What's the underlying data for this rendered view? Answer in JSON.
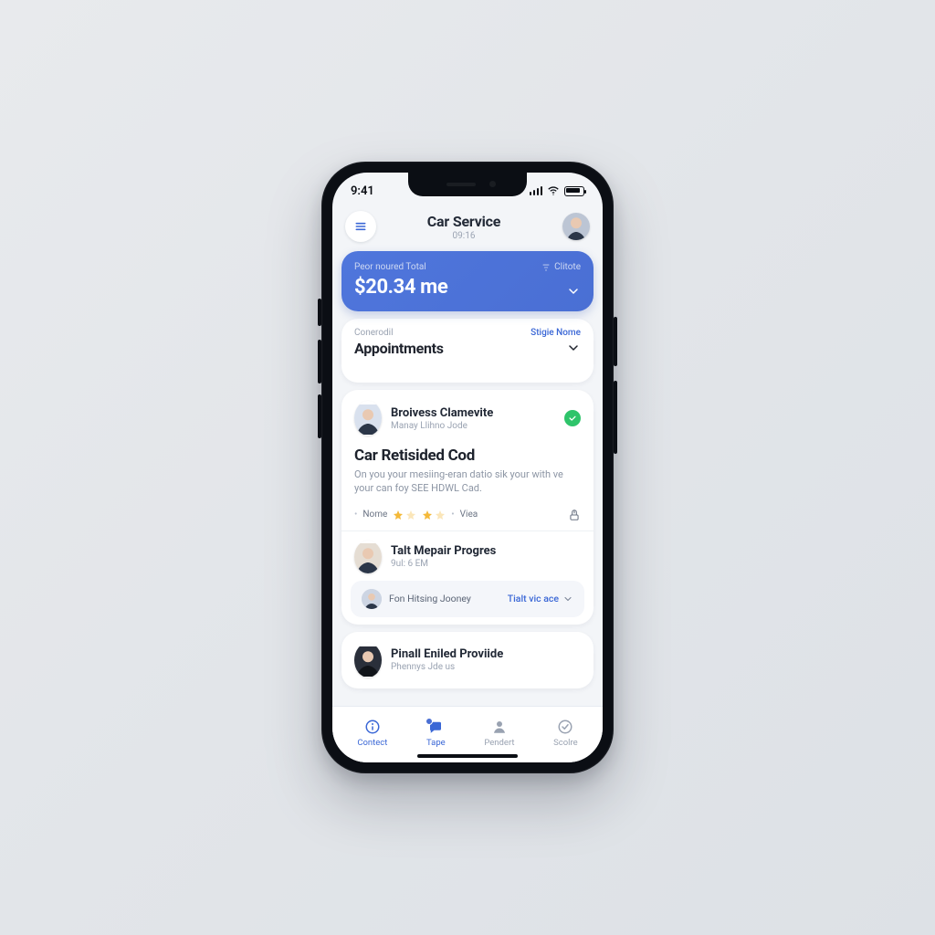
{
  "colors": {
    "accent": "#4a6fd4",
    "success": "#2ec46a",
    "star": "#f4b93a"
  },
  "status": {
    "time": "9:41"
  },
  "header": {
    "title": "Car Service",
    "subtitle": "09:16"
  },
  "total": {
    "label": "Peor noured Total",
    "right_label": "Clitote",
    "amount": "$20.34 me"
  },
  "appointments_section": {
    "overline": "Conerodil",
    "right_link": "Stigie Nome",
    "title": "Appointments"
  },
  "appointment1": {
    "name": "Broivess Clamevite",
    "meta": "Manay Llihno Jode",
    "job_title": "Car Retisided Cod",
    "job_desc": "On you your mesiing-eran datio sik your with ve your can foy SEE HDWL Cad.",
    "info_left": "Nome",
    "info_right": "Viea",
    "progress_name": "Talt Mepair Progres",
    "progress_time": "9ul: 6 EM",
    "footer_left": "Fon Hitsing Jooney",
    "footer_right": "Tialt vic ace"
  },
  "appointment2": {
    "name": "Pinall Eniled Proviide",
    "meta": "Phennys Jde us"
  },
  "tabs": [
    {
      "label": "Contect"
    },
    {
      "label": "Tape"
    },
    {
      "label": "Pendert"
    },
    {
      "label": "Scolre"
    }
  ]
}
